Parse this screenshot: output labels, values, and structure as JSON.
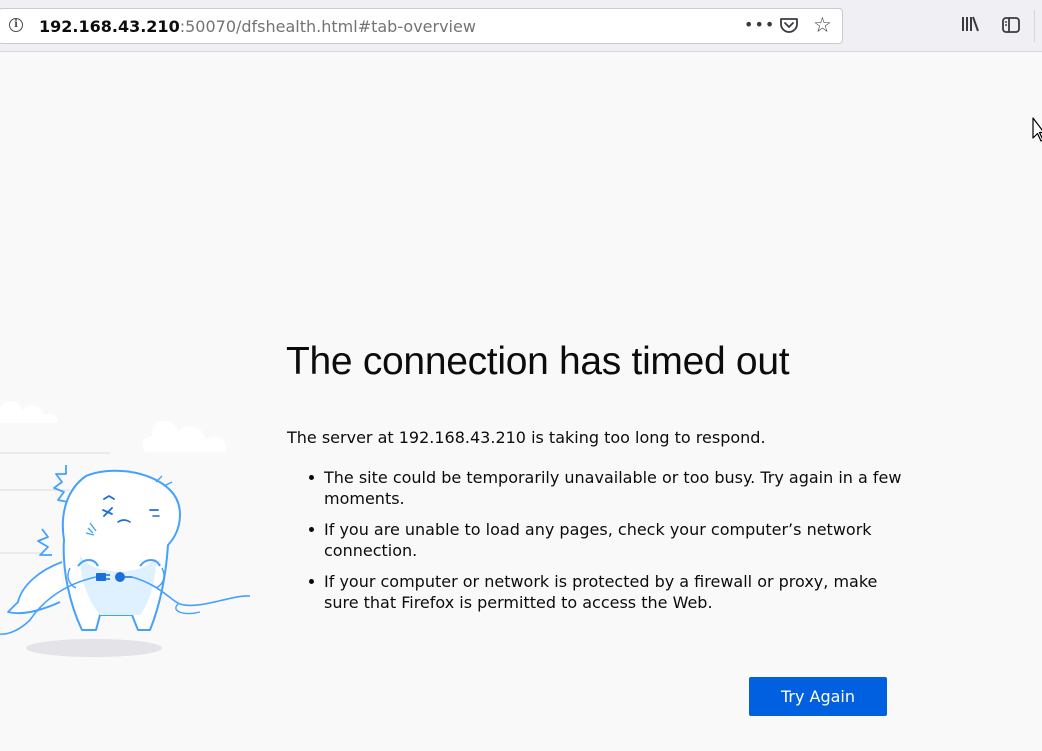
{
  "urlbar": {
    "host": "192.168.43.210",
    "rest": ":50070/dfshealth.html#tab-overview",
    "info_icon": "i",
    "page_actions_icon": "•••"
  },
  "error": {
    "title": "The connection has timed out",
    "description": "The server at 192.168.43.210 is taking too long to respond.",
    "suggestions": [
      "The site could be temporarily unavailable or too busy. Try again in a few moments.",
      "If you are unable to load any pages, check your computer’s network connection.",
      "If your computer or network is protected by a firewall or proxy, make sure that Firefox is permitted to access the Web."
    ],
    "button_label": "Try Again"
  },
  "colors": {
    "accent": "#0060df",
    "background": "#f9f9fa",
    "text": "#0c0c0d",
    "illustration": "#45a1ff"
  },
  "icons": [
    "info-icon",
    "page-actions-icon",
    "pocket-icon",
    "bookmark-star-icon",
    "library-icon",
    "sidebar-icon",
    "mouse-cursor-icon"
  ]
}
